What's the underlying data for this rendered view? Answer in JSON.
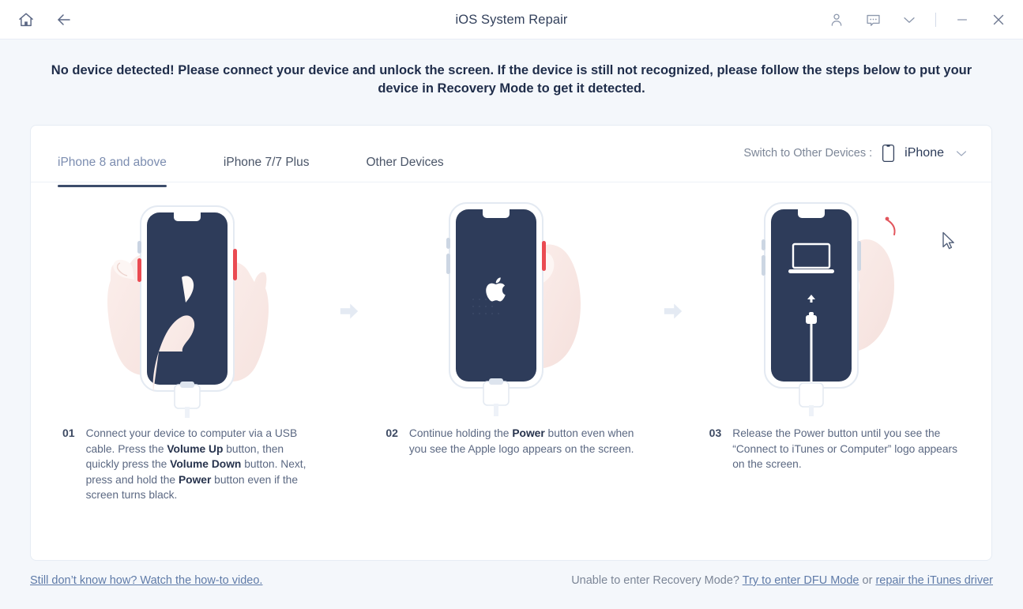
{
  "titlebar": {
    "title": "iOS System Repair",
    "home_icon": "home-icon",
    "back_icon": "back-arrow-icon",
    "account_icon": "user-account-icon",
    "feedback_icon": "chat-bubble-icon",
    "more_icon": "chevron-down-icon",
    "minimize_icon": "minimize-icon",
    "close_icon": "close-icon"
  },
  "headline": "No device detected! Please connect your device and unlock the screen. If the device is still not recognized, please follow the steps below to put your device in Recovery Mode to get it detected.",
  "tabs": [
    {
      "label": "iPhone 8 and above",
      "active": true
    },
    {
      "label": "iPhone 7/7 Plus",
      "active": false
    },
    {
      "label": "Other Devices",
      "active": false
    }
  ],
  "switch_devices": {
    "label": "Switch to Other Devices :",
    "device_icon": "phone-icon",
    "value": "iPhone",
    "chevron": "chevron-down-icon"
  },
  "steps": [
    {
      "number": "01",
      "illustration": "two-hands-holding-iphone-pressing-volume-and-power-buttons",
      "text_parts": [
        {
          "t": "Connect your device to computer via a USB cable. Press the ",
          "b": false
        },
        {
          "t": "Volume Up",
          "b": true
        },
        {
          "t": " button, then quickly press the ",
          "b": false
        },
        {
          "t": "Volume Down",
          "b": true
        },
        {
          "t": " button. Next, press and hold the ",
          "b": false
        },
        {
          "t": "Power",
          "b": true
        },
        {
          "t": " button even if the screen turns black.",
          "b": false
        }
      ]
    },
    {
      "number": "02",
      "illustration": "iphone-showing-apple-logo-hand-holding-power-button",
      "text_parts": [
        {
          "t": "Continue holding the ",
          "b": false
        },
        {
          "t": "Power",
          "b": true
        },
        {
          "t": " button even when you see the Apple logo appears on the screen.",
          "b": false
        }
      ]
    },
    {
      "number": "03",
      "illustration": "iphone-showing-connect-to-itunes-or-computer-screen-hand-releasing",
      "text_parts": [
        {
          "t": "Release the Power button until you see the “Connect to iTunes or Computer” logo appears on the screen.",
          "b": false
        }
      ]
    }
  ],
  "footer": {
    "video_link": "Still don’t know how? Watch the how-to video.",
    "right_prefix": "Unable to enter Recovery Mode? ",
    "dfu_link": "Try to enter DFU Mode",
    "right_middle": " or ",
    "driver_link": "repair the iTunes driver"
  },
  "colors": {
    "page_bg": "#f4f7fb",
    "card_bg": "#ffffff",
    "headline": "#1f2d4a",
    "accent_link": "#5f7ba8",
    "tab_active_underline": "#3d4c6b",
    "screen_navy": "#2e3c5a",
    "highlight_red": "#e8ararr"
  }
}
